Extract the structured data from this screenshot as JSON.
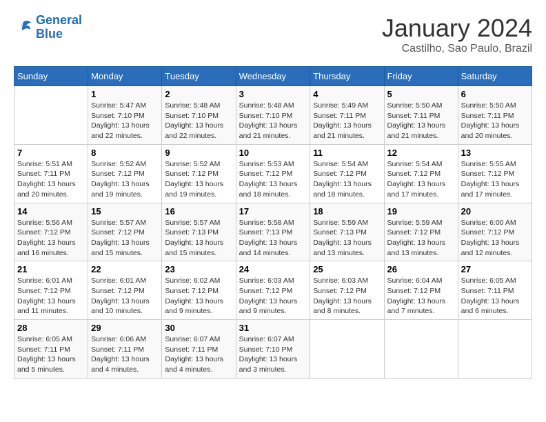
{
  "logo": {
    "line1": "General",
    "line2": "Blue"
  },
  "title": "January 2024",
  "subtitle": "Castilho, Sao Paulo, Brazil",
  "weekdays": [
    "Sunday",
    "Monday",
    "Tuesday",
    "Wednesday",
    "Thursday",
    "Friday",
    "Saturday"
  ],
  "weeks": [
    [
      null,
      {
        "day": "1",
        "sunrise": "5:47 AM",
        "sunset": "7:10 PM",
        "daylight": "13 hours and 22 minutes."
      },
      {
        "day": "2",
        "sunrise": "5:48 AM",
        "sunset": "7:10 PM",
        "daylight": "13 hours and 22 minutes."
      },
      {
        "day": "3",
        "sunrise": "5:48 AM",
        "sunset": "7:10 PM",
        "daylight": "13 hours and 21 minutes."
      },
      {
        "day": "4",
        "sunrise": "5:49 AM",
        "sunset": "7:11 PM",
        "daylight": "13 hours and 21 minutes."
      },
      {
        "day": "5",
        "sunrise": "5:50 AM",
        "sunset": "7:11 PM",
        "daylight": "13 hours and 21 minutes."
      },
      {
        "day": "6",
        "sunrise": "5:50 AM",
        "sunset": "7:11 PM",
        "daylight": "13 hours and 20 minutes."
      }
    ],
    [
      {
        "day": "7",
        "sunrise": "5:51 AM",
        "sunset": "7:11 PM",
        "daylight": "13 hours and 20 minutes."
      },
      {
        "day": "8",
        "sunrise": "5:52 AM",
        "sunset": "7:12 PM",
        "daylight": "13 hours and 19 minutes."
      },
      {
        "day": "9",
        "sunrise": "5:52 AM",
        "sunset": "7:12 PM",
        "daylight": "13 hours and 19 minutes."
      },
      {
        "day": "10",
        "sunrise": "5:53 AM",
        "sunset": "7:12 PM",
        "daylight": "13 hours and 18 minutes."
      },
      {
        "day": "11",
        "sunrise": "5:54 AM",
        "sunset": "7:12 PM",
        "daylight": "13 hours and 18 minutes."
      },
      {
        "day": "12",
        "sunrise": "5:54 AM",
        "sunset": "7:12 PM",
        "daylight": "13 hours and 17 minutes."
      },
      {
        "day": "13",
        "sunrise": "5:55 AM",
        "sunset": "7:12 PM",
        "daylight": "13 hours and 17 minutes."
      }
    ],
    [
      {
        "day": "14",
        "sunrise": "5:56 AM",
        "sunset": "7:12 PM",
        "daylight": "13 hours and 16 minutes."
      },
      {
        "day": "15",
        "sunrise": "5:57 AM",
        "sunset": "7:12 PM",
        "daylight": "13 hours and 15 minutes."
      },
      {
        "day": "16",
        "sunrise": "5:57 AM",
        "sunset": "7:13 PM",
        "daylight": "13 hours and 15 minutes."
      },
      {
        "day": "17",
        "sunrise": "5:58 AM",
        "sunset": "7:13 PM",
        "daylight": "13 hours and 14 minutes."
      },
      {
        "day": "18",
        "sunrise": "5:59 AM",
        "sunset": "7:13 PM",
        "daylight": "13 hours and 13 minutes."
      },
      {
        "day": "19",
        "sunrise": "5:59 AM",
        "sunset": "7:12 PM",
        "daylight": "13 hours and 13 minutes."
      },
      {
        "day": "20",
        "sunrise": "6:00 AM",
        "sunset": "7:12 PM",
        "daylight": "13 hours and 12 minutes."
      }
    ],
    [
      {
        "day": "21",
        "sunrise": "6:01 AM",
        "sunset": "7:12 PM",
        "daylight": "13 hours and 11 minutes."
      },
      {
        "day": "22",
        "sunrise": "6:01 AM",
        "sunset": "7:12 PM",
        "daylight": "13 hours and 10 minutes."
      },
      {
        "day": "23",
        "sunrise": "6:02 AM",
        "sunset": "7:12 PM",
        "daylight": "13 hours and 9 minutes."
      },
      {
        "day": "24",
        "sunrise": "6:03 AM",
        "sunset": "7:12 PM",
        "daylight": "13 hours and 9 minutes."
      },
      {
        "day": "25",
        "sunrise": "6:03 AM",
        "sunset": "7:12 PM",
        "daylight": "13 hours and 8 minutes."
      },
      {
        "day": "26",
        "sunrise": "6:04 AM",
        "sunset": "7:12 PM",
        "daylight": "13 hours and 7 minutes."
      },
      {
        "day": "27",
        "sunrise": "6:05 AM",
        "sunset": "7:11 PM",
        "daylight": "13 hours and 6 minutes."
      }
    ],
    [
      {
        "day": "28",
        "sunrise": "6:05 AM",
        "sunset": "7:11 PM",
        "daylight": "13 hours and 5 minutes."
      },
      {
        "day": "29",
        "sunrise": "6:06 AM",
        "sunset": "7:11 PM",
        "daylight": "13 hours and 4 minutes."
      },
      {
        "day": "30",
        "sunrise": "6:07 AM",
        "sunset": "7:11 PM",
        "daylight": "13 hours and 4 minutes."
      },
      {
        "day": "31",
        "sunrise": "6:07 AM",
        "sunset": "7:10 PM",
        "daylight": "13 hours and 3 minutes."
      },
      null,
      null,
      null
    ]
  ]
}
